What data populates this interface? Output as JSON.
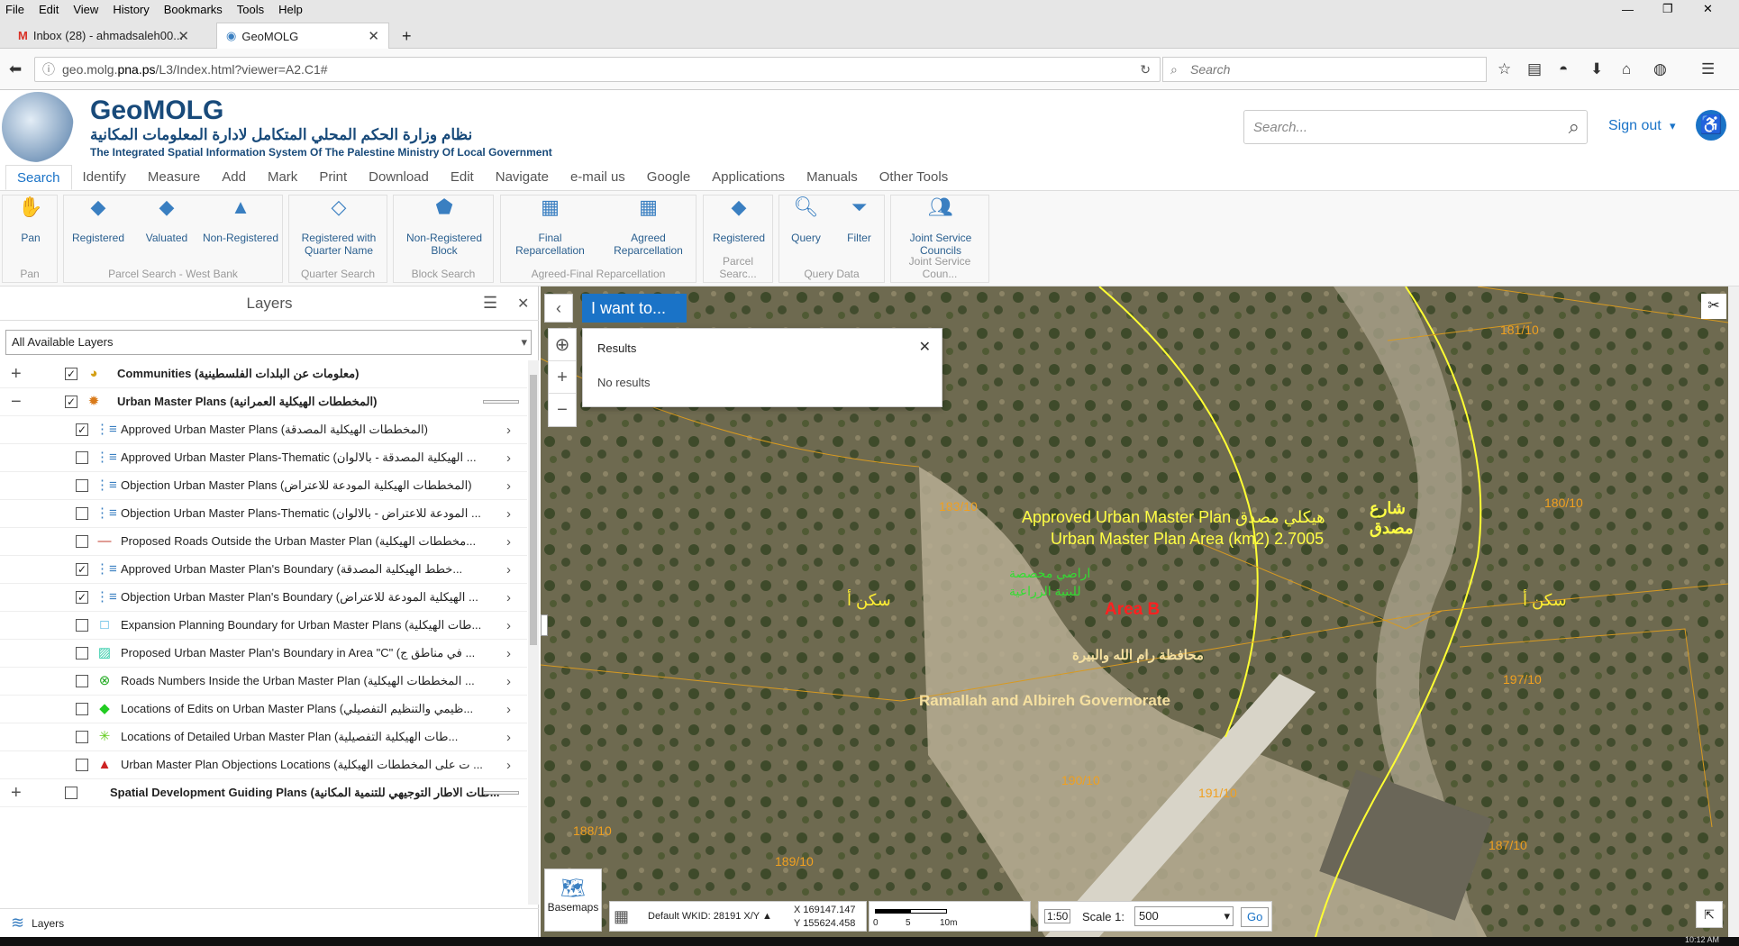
{
  "browser": {
    "menu": [
      "File",
      "Edit",
      "View",
      "History",
      "Bookmarks",
      "Tools",
      "Help"
    ],
    "tabs": [
      {
        "label": "Inbox (28) - ahmadsaleh00..."
      },
      {
        "label": "GeoMOLG"
      }
    ],
    "url_prefix": "geo.molg.",
    "url_domain": "pna.ps",
    "url_path": "/L3/Index.html?viewer=A2.C1#",
    "search_placeholder": "Search"
  },
  "header": {
    "brand": "GeoMOLG",
    "arabic_title": "نظام وزارة الحكم المحلي المتكامل لادارة المعلومات المكانية",
    "english_title": "The Integrated Spatial Information System Of The Palestine Ministry Of Local Government",
    "search_placeholder": "Search...",
    "sign_out": "Sign out"
  },
  "ribbon_tabs": [
    "Search",
    "Identify",
    "Measure",
    "Add",
    "Mark",
    "Print",
    "Download",
    "Edit",
    "Navigate",
    "e-mail us",
    "Google",
    "Applications",
    "Manuals",
    "Other Tools"
  ],
  "ribbon_groups": {
    "pan": {
      "title": "Pan",
      "buttons": [
        "Pan"
      ]
    },
    "parcel_wb": {
      "title": "Parcel Search - West Bank",
      "buttons": [
        "Registered",
        "Valuated",
        "Non-Registered"
      ]
    },
    "quarter": {
      "title": "Quarter Search",
      "buttons": [
        "Registered with Quarter Name"
      ]
    },
    "block": {
      "title": "Block Search",
      "buttons": [
        "Non-Registered Block"
      ]
    },
    "agreed": {
      "title": "Agreed-Final Reparcellation",
      "buttons": [
        "Final Reparcellation",
        "Agreed Reparcellation"
      ]
    },
    "parcel2": {
      "title": "Parcel Searc...",
      "buttons": [
        "Registered"
      ]
    },
    "query": {
      "title": "Query Data",
      "buttons": [
        "Query",
        "Filter"
      ]
    },
    "joint": {
      "title": "Joint Service Coun...",
      "buttons": [
        "Joint Service Councils"
      ]
    }
  },
  "layers_panel": {
    "title": "Layers",
    "select_value": "All Available Layers",
    "footer": "Layers",
    "rows": [
      {
        "label": "Communities (معلومات عن البلدات الفلسطينية)",
        "checked": "✓",
        "pm": "+"
      },
      {
        "label": "Urban Master Plans (المخططات الهيكلية العمرانية)",
        "checked": "✓",
        "pm": "−"
      },
      {
        "label": "Approved Urban Master Plans (المخططات الهيكلية المصدقة)",
        "checked": "✓"
      },
      {
        "label": "Approved Urban Master Plans-Thematic (الهيكلية المصدقة - بالالوان ...",
        "checked": ""
      },
      {
        "label": "Objection Urban Master Plans (المخططات الهيكلية المودعة للاعتراض)",
        "checked": ""
      },
      {
        "label": "Objection Urban Master Plans-Thematic (المودعة للاعتراض - بالالوان ...",
        "checked": ""
      },
      {
        "label": "Proposed Roads Outside the Urban Master Plan (مخططات الهيكلية...",
        "checked": ""
      },
      {
        "label": "Approved Urban Master Plan's Boundary (خطط الهيكلية المصدقة...",
        "checked": "✓"
      },
      {
        "label": "Objection Urban Master Plan's Boundary (الهيكلية المودعة للاعتراض ...",
        "checked": "✓"
      },
      {
        "label": "Expansion Planning Boundary for Urban Master Plans (طات الهيكلية...",
        "checked": ""
      },
      {
        "label": "Proposed Urban Master Plan's Boundary in Area \"C\" (في مناطق ج ...",
        "checked": ""
      },
      {
        "label": "Roads Numbers Inside the Urban Master Plan (المخططات الهيكلية ...",
        "checked": ""
      },
      {
        "label": "Locations of Edits on Urban Master Plans (ظيمي والتنظيم التفصيلي...",
        "checked": ""
      },
      {
        "label": "Locations of Detailed Urban Master Plan (طات الهيكلية التفصيلية...",
        "checked": ""
      },
      {
        "label": "Urban Master Plan Objections Locations (ت على المخططات الهيكلية ...",
        "checked": ""
      },
      {
        "label": "Spatial Development Guiding Plans (طات الاطار التوجيهي للتنمية المكانية...",
        "checked": "",
        "pm": "+"
      }
    ]
  },
  "map": {
    "i_want_to": "I want to...",
    "results_title": "Results",
    "results_text": "No results",
    "labels": {
      "plan_line1": "Approved Urban Master Plan هيكلي مصدق",
      "plan_line2": "Urban Master Plan Area (km2) 2.7005",
      "area": "Area B",
      "gov_ar": "محافظة رام الله والبيرة",
      "gov_en": "Ramallah and Albireh Governorate",
      "agri_ar1": "اراضي مخصصة",
      "agri_ar2": "للبنية الزراعية",
      "sakan": "سكن أ",
      "shari": "شارع",
      "masdaq": "مصدق",
      "parcels": [
        "181/10",
        "183/10",
        "180/10",
        "197/10",
        "190/10",
        "191/10",
        "188/10",
        "189/10",
        "187/10"
      ]
    },
    "basemaps": "Basemaps",
    "wkid": "Default WKID: 28191 X/Y ▲",
    "x": "X  169147.147",
    "y": "Y  155624.458",
    "scalebar": [
      "0",
      "5",
      "10m"
    ],
    "scale_label": "Scale 1:",
    "scale_value": "500",
    "go": "Go"
  },
  "taskbar_time": "10:12 AM"
}
